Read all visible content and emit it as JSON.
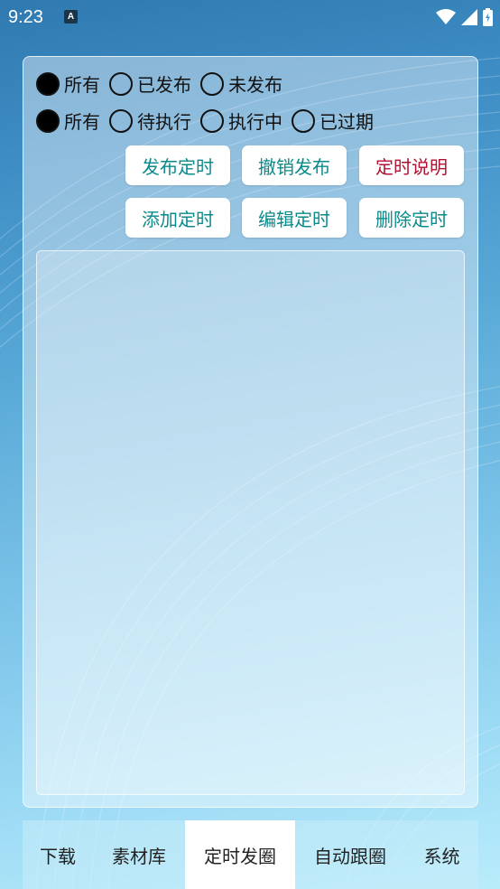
{
  "status_bar": {
    "time": "9:23",
    "notification_icon": "a-app-icon",
    "icons": [
      "wifi-icon",
      "signal-icon",
      "battery-icon"
    ]
  },
  "filters": {
    "publish_status": {
      "options": [
        "所有",
        "已发布",
        "未发布"
      ],
      "selected": "所有"
    },
    "execution_status": {
      "options": [
        "所有",
        "待执行",
        "执行中",
        "已过期"
      ],
      "selected": "所有"
    }
  },
  "actions": {
    "publish_timer": "发布定时",
    "cancel_publish": "撤销发布",
    "timer_help": "定时说明",
    "add_timer": "添加定时",
    "edit_timer": "编辑定时",
    "delete_timer": "删除定时"
  },
  "tabs": [
    {
      "label": "下载",
      "active": false
    },
    {
      "label": "素材库",
      "active": false
    },
    {
      "label": "定时发圈",
      "active": true
    },
    {
      "label": "自动跟圈",
      "active": false
    },
    {
      "label": "系统",
      "active": false
    }
  ],
  "colors": {
    "action_text": "#0a8a8a",
    "help_text": "#b01230",
    "radio_checked": "#000000"
  }
}
